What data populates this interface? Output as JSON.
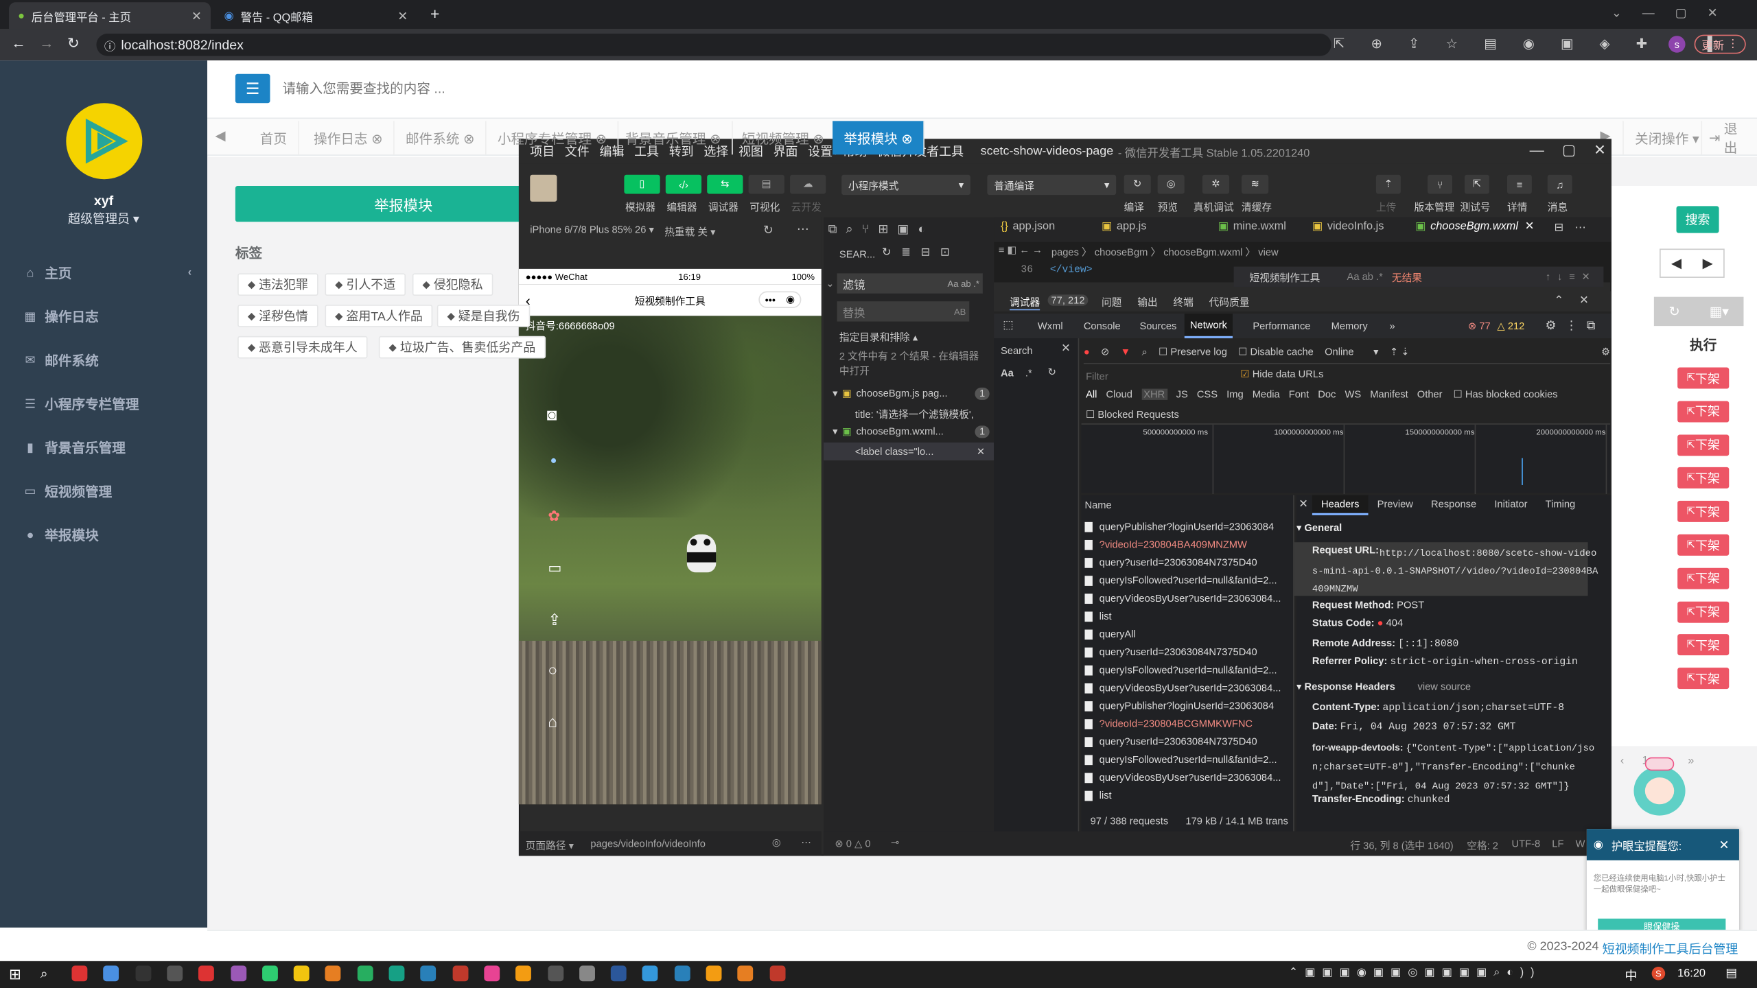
{
  "browser": {
    "tabs": [
      {
        "label": "后台管理平台 - 主页",
        "active": true
      },
      {
        "label": "警告 - QQ邮箱",
        "active": false
      }
    ],
    "url": "localhost:8082/index",
    "update_label": "更新",
    "profile_initial": "s"
  },
  "sidebar": {
    "username": "xyf",
    "role": "超级管理员 ▾",
    "items": [
      {
        "icon": "home-icon",
        "glyph": "⌂",
        "label": "主页"
      },
      {
        "icon": "calendar-icon",
        "glyph": "▦",
        "label": "操作日志"
      },
      {
        "icon": "mail-icon",
        "glyph": "✉",
        "label": "邮件系统"
      },
      {
        "icon": "list-icon",
        "glyph": "☰",
        "label": "小程序专栏管理"
      },
      {
        "icon": "bar-chart-icon",
        "glyph": "▮",
        "label": "背景音乐管理"
      },
      {
        "icon": "monitor-icon",
        "glyph": "▭",
        "label": "短视频管理"
      },
      {
        "icon": "warning-icon",
        "glyph": "●",
        "label": "举报模块"
      }
    ]
  },
  "header": {
    "search_placeholder": "请输入您需要查找的内容 ..."
  },
  "page_tabs": [
    "首页",
    "操作日志 ⊗",
    "邮件系统 ⊗",
    "小程序专栏管理 ⊗",
    "背景音乐管理 ⊗",
    "短视频管理 ⊗",
    "举报模块 ⊗"
  ],
  "right_tabs": {
    "close_ops": "关闭操作 ▾",
    "logout": "退出"
  },
  "report": {
    "title_button": "举报模块",
    "section_label": "标签",
    "tags": [
      "违法犯罪",
      "引人不适",
      "侵犯隐私",
      "淫秽色情",
      "盗用TA人作品",
      "疑是自我伤",
      "恶意引导未成年人",
      "垃圾广告、售卖低劣产品"
    ],
    "search_button": "搜索",
    "exec_header": "执行",
    "down_label": "下架",
    "down_count": 10,
    "pager": [
      "‹",
      "1",
      "›",
      "»"
    ]
  },
  "devtools": {
    "menu": [
      "项目",
      "文件",
      "编辑",
      "工具",
      "转到",
      "选择",
      "视图",
      "界面",
      "设置",
      "帮助",
      "微信开发者工具"
    ],
    "window_title": "scetc-show-videos-page",
    "version": "- 微信开发者工具 Stable 1.05.2201240",
    "toolbar_buttons": [
      "模拟器",
      "编辑器",
      "调试器",
      "可视化",
      "云开发"
    ],
    "mode_select": "小程序模式",
    "compile_select": "普通编译",
    "right_tools": [
      "编译",
      "预览",
      "真机调试",
      "清缓存"
    ],
    "far_right_tools": [
      "上传",
      "版本管理",
      "测试号",
      "详情",
      "消息"
    ],
    "device": "iPhone 6/7/8 Plus 85% 26 ▾",
    "hotreload": "热重载 关 ▾",
    "sim": {
      "carrier": "●●●●● WeChat",
      "time": "16:19",
      "battery": "100%",
      "title": "短视频制作工具",
      "overlay_text": "抖音号:6666668o09"
    },
    "sim_footer_path": "pages/videoInfo/videoInfo",
    "sim_footer_label": "页面路径 ▾",
    "search_panel": {
      "label": "SEAR...",
      "search_value": "滤镜",
      "replace_placeholder": "替换",
      "include_label": "指定目录和排除 ▴",
      "result_summary": "2 文件中有 2 个结果 - 在编辑器中打开",
      "files": [
        {
          "name": "chooseBgm.js pag...",
          "count": "1",
          "match": "title: '请选择一个滤镜模板',"
        },
        {
          "name": "chooseBgm.wxml...",
          "count": "1",
          "match": "<label class=\"lo..."
        }
      ]
    },
    "editor_tabs": [
      "app.json",
      "app.js",
      "mine.wxml",
      "videoInfo.js",
      "chooseBgm.wxml"
    ],
    "breadcrumb": "pages 〉 chooseBgm 〉 chooseBgm.wxml 〉 view",
    "line_no": "36",
    "line_code": "</view>",
    "find_value": "短视频制作工具",
    "find_result": "无结果",
    "debug_tabs": [
      "调试器",
      "77, 212",
      "问题",
      "输出",
      "终端",
      "代码质量"
    ],
    "panel_tabs": [
      "Wxml",
      "Console",
      "Sources",
      "Network",
      "Performance",
      "Memory",
      "»"
    ],
    "error_count": "77",
    "warn_count": "212",
    "net_toolbar": {
      "preserve": "Preserve log",
      "disable_cache": "Disable cache",
      "throttle": "Online"
    },
    "filter_placeholder": "Filter",
    "hide_data_urls": "Hide data URLs",
    "type_filters": [
      "All",
      "Cloud",
      "XHR",
      "JS",
      "CSS",
      "Img",
      "Media",
      "Font",
      "Doc",
      "WS",
      "Manifest",
      "Other"
    ],
    "has_blocked": "Has blocked cookies",
    "blocked_requests": "Blocked Requests",
    "timeline_ticks": [
      "500000000000 ms",
      "1000000000000 ms",
      "1500000000000 ms",
      "2000000000000 ms"
    ],
    "search_label": "Search",
    "name_header": "Name",
    "requests": [
      {
        "name": "queryPublisher?loginUserId=23063084",
        "error": false
      },
      {
        "name": "?videoId=230804BA409MNZMW",
        "error": true
      },
      {
        "name": "query?userId=23063084N7375D40",
        "error": false
      },
      {
        "name": "queryIsFollowed?userId=null&fanId=2...",
        "error": false
      },
      {
        "name": "queryVideosByUser?userId=23063084...",
        "error": false
      },
      {
        "name": "list",
        "error": false
      },
      {
        "name": "queryAll",
        "error": false
      },
      {
        "name": "query?userId=23063084N7375D40",
        "error": false
      },
      {
        "name": "queryIsFollowed?userId=null&fanId=2...",
        "error": false
      },
      {
        "name": "queryVideosByUser?userId=23063084...",
        "error": false
      },
      {
        "name": "queryPublisher?loginUserId=23063084",
        "error": false
      },
      {
        "name": "?videoId=230804BCGMMKWFNC",
        "error": true
      },
      {
        "name": "query?userId=23063084N7375D40",
        "error": false
      },
      {
        "name": "queryIsFollowed?userId=null&fanId=2...",
        "error": false
      },
      {
        "name": "queryVideosByUser?userId=23063084...",
        "error": false
      },
      {
        "name": "list",
        "error": false
      }
    ],
    "req_summary": "97 / 388 requests",
    "transfer": "179 kB / 14.1 MB trans",
    "detail_tabs": [
      "Headers",
      "Preview",
      "Response",
      "Initiator",
      "Timing"
    ],
    "general_label": "▾ General",
    "request_url_label": "Request URL:",
    "request_url": "http://localhost:8080/scetc-show-videos-mini-api-0.0.1-SNAPSHOT//video/?videoId=230804BA409MNZMW",
    "method_label": "Request Method:",
    "method": "POST",
    "status_label": "Status Code:",
    "status": "404",
    "remote_label": "Remote Address:",
    "remote": "[::1]:8080",
    "referrer_label": "Referrer Policy:",
    "referrer": "strict-origin-when-cross-origin",
    "resp_headers_label": "▾ Response Headers",
    "view_source": "view source",
    "content_type_label": "Content-Type:",
    "content_type": "application/json;charset=UTF-8",
    "date_label": "Date:",
    "date": "Fri, 04 Aug 2023 07:57:32 GMT",
    "weapp_label": "for-weapp-devtools:",
    "weapp_value": "{\"Content-Type\":[\"application/json;charset=UTF-8\"],\"Transfer-Encoding\":[\"chunked\"],\"Date\":[\"Fri, 04 Aug 2023 07:57:32 GMT\"]}",
    "te_label": "Transfer-Encoding:",
    "te": "chunked",
    "status_bar": {
      "left": "⊗ 0 △ 0",
      "pos": "行 36, 列 8 (选中 1640)",
      "space": "空格: 2",
      "enc": "UTF-8",
      "eol": "LF",
      "lang": "W"
    }
  },
  "popup": {
    "title": "护眼宝提醒您:",
    "body": "您已经连续使用电脑1小时,快跟小护士一起做眼保健操吧~",
    "button": "眼保健操"
  },
  "footer": {
    "copyright": "© 2023-2024",
    "link": "短视频制作工具后台管理"
  },
  "taskbar": {
    "time": "16:20",
    "ime": "中",
    "ime2": "S"
  }
}
